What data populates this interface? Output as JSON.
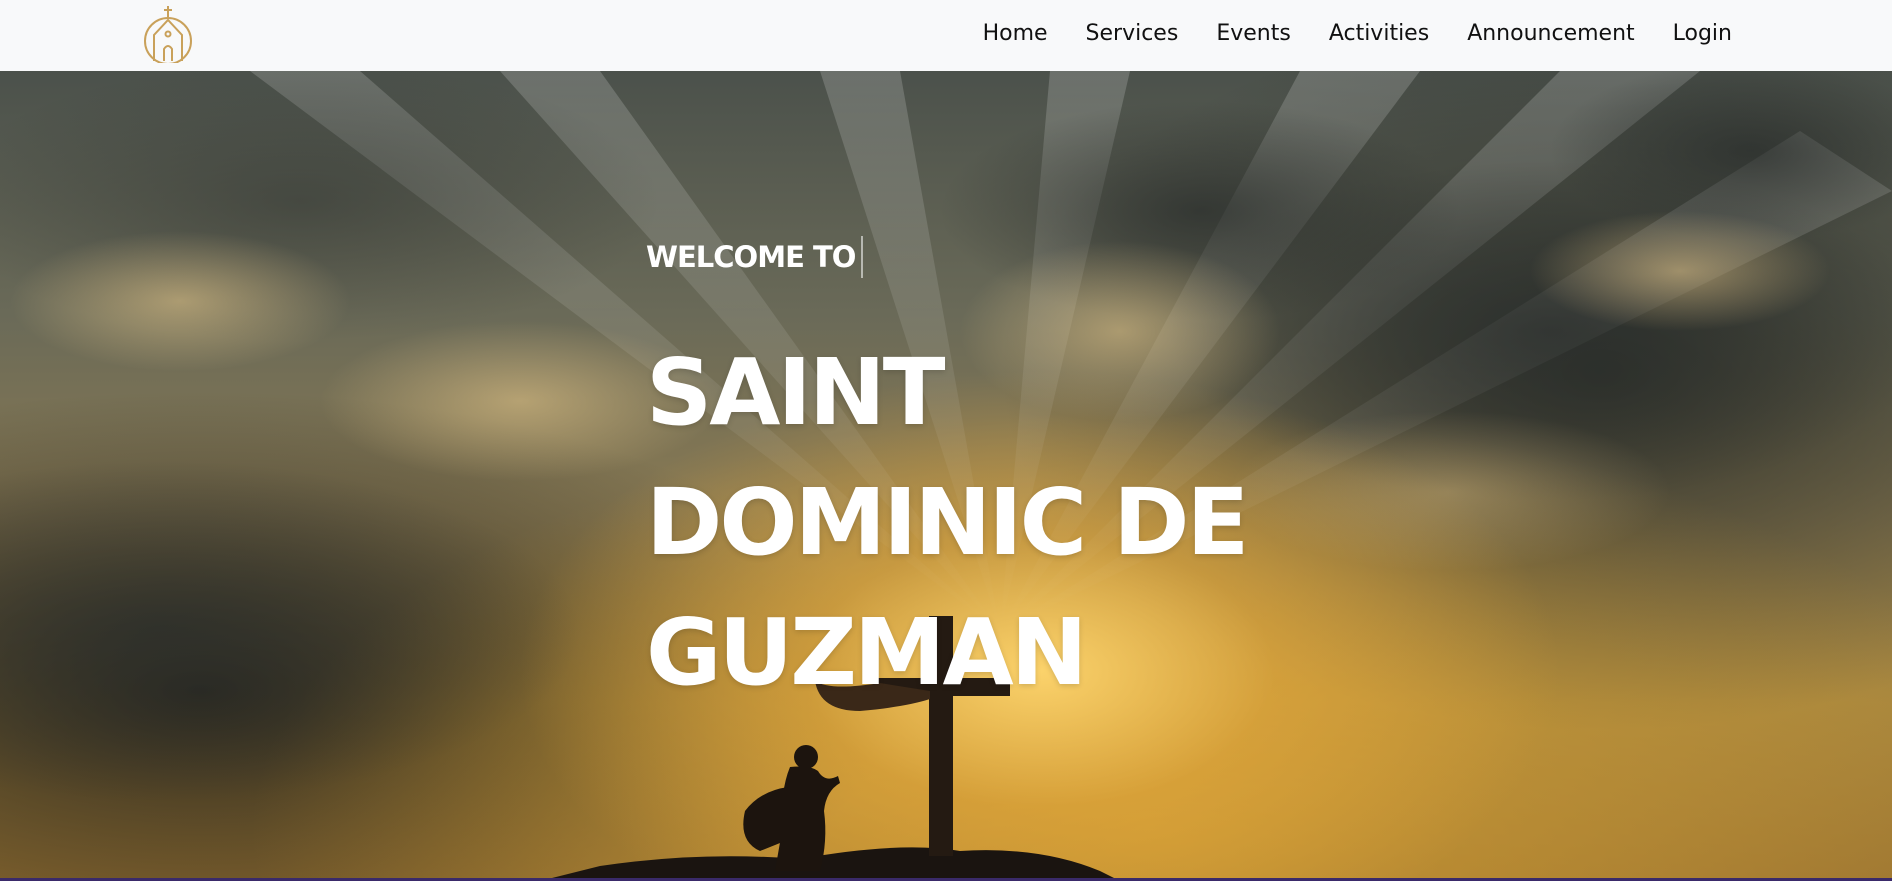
{
  "navbar": {
    "logo_icon": "church-icon",
    "logo_color": "#c9a15a",
    "links": [
      {
        "label": "Home"
      },
      {
        "label": "Services"
      },
      {
        "label": "Events"
      },
      {
        "label": "Activities"
      },
      {
        "label": "Announcement"
      },
      {
        "label": "Login"
      }
    ]
  },
  "hero": {
    "welcome": "WELCOME TO",
    "title_lines": [
      "SAINT",
      "DOMINIC DE",
      "GUZMAN"
    ],
    "background": "sunset-sky-with-cross-and-silhouette"
  }
}
